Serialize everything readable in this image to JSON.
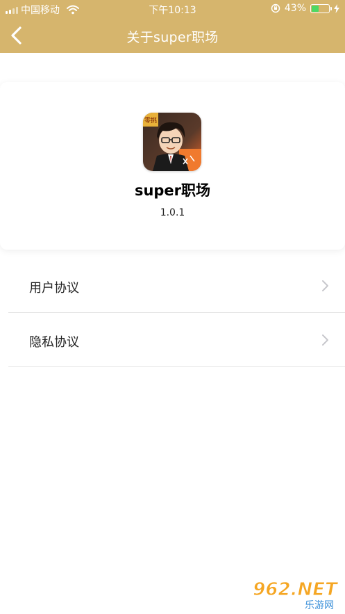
{
  "status_bar": {
    "carrier": "中国移动",
    "time": "下午10:13",
    "battery_percent": "43%",
    "battery_level": 0.43
  },
  "nav": {
    "title": "关于super职场"
  },
  "app": {
    "name": "super职场",
    "version": "1.0.1",
    "icon_badge": "零挑"
  },
  "menu": {
    "items": [
      {
        "label": "用户协议"
      },
      {
        "label": "隐私协议"
      }
    ]
  },
  "watermark": {
    "brand": "962.NET",
    "subtitle": "乐游网"
  },
  "colors": {
    "header": "#d6b56d",
    "battery_fill": "#4cd964",
    "chevron": "#c7c7cc"
  }
}
